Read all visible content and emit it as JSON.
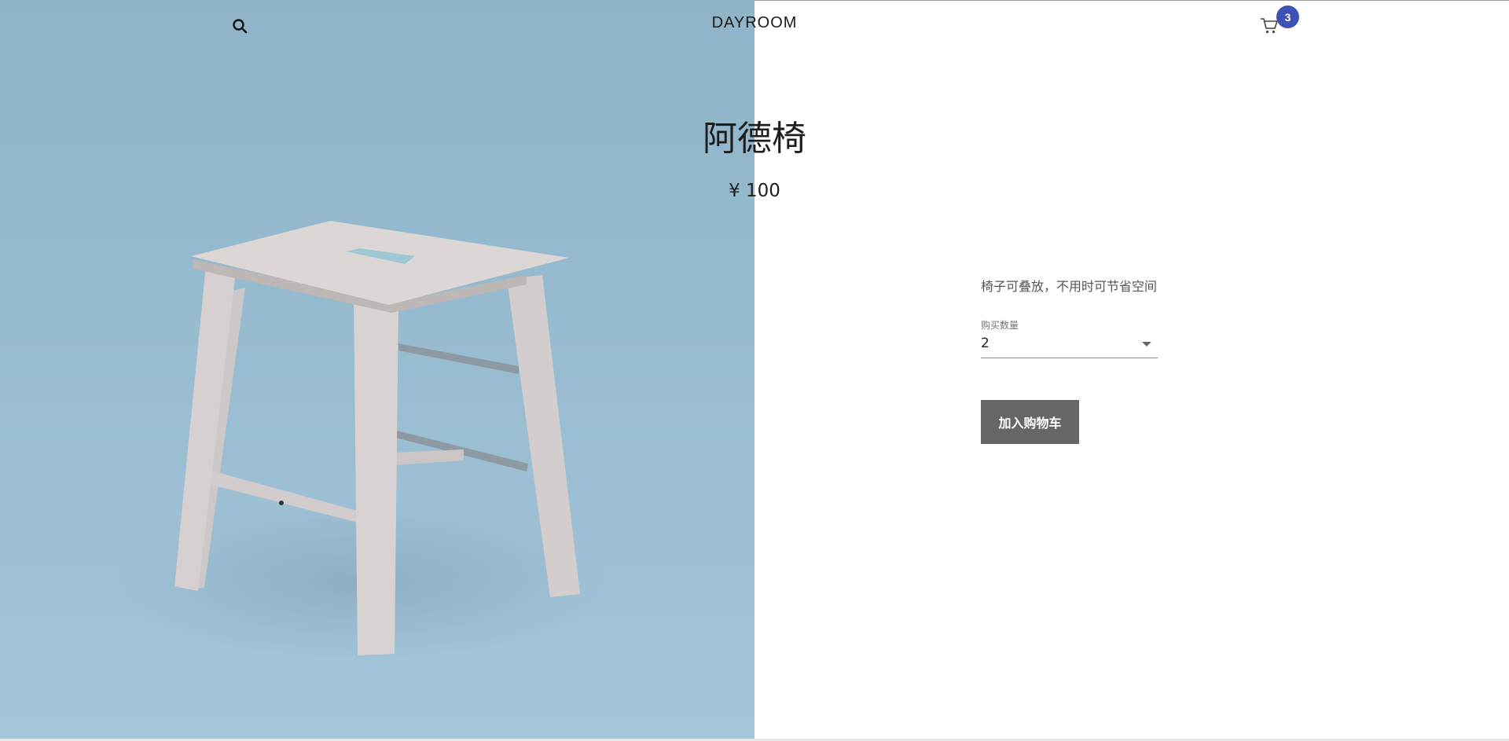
{
  "header": {
    "logo": "DAYROOM",
    "search_icon": "search-icon",
    "cart_icon": "cart-icon",
    "cart_count": "3"
  },
  "product": {
    "title": "阿德椅",
    "price": "¥ 100",
    "description": "椅子可叠放，不用时可节省空间",
    "quantity_label": "购买数量",
    "quantity_value": "2",
    "add_to_cart_label": "加入购物车",
    "image_subject": "wooden stool on blue background"
  },
  "colors": {
    "hero_background": "#97bbcf",
    "badge": "#3f51b5",
    "button": "#666666",
    "text": "#1e1e1e"
  }
}
